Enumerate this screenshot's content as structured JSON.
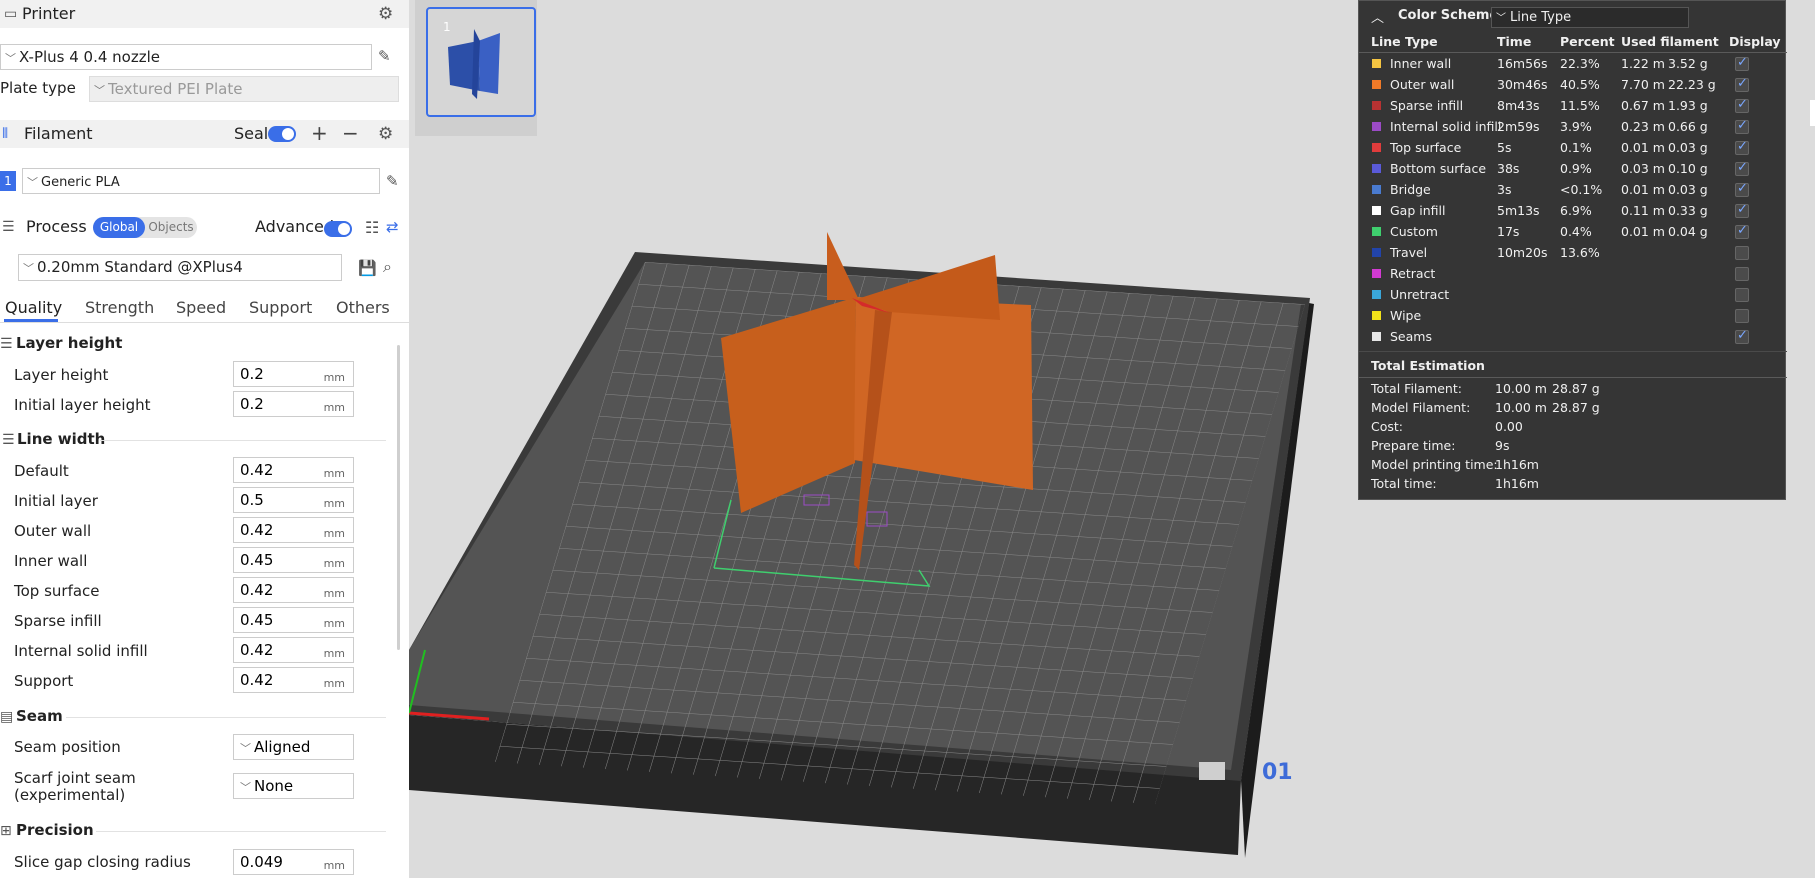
{
  "printer": {
    "title": "Printer",
    "model": "X-Plus 4 0.4 nozzle",
    "plate_label": "Plate type",
    "plate_value": "Textured PEI Plate"
  },
  "filament": {
    "title": "Filament",
    "seal_label": "Seal",
    "slot": "1",
    "value": "Generic PLA"
  },
  "process": {
    "title": "Process",
    "global": "Global",
    "objects": "Objects",
    "advanced": "Advanced",
    "preset": "0.20mm Standard @XPlus4"
  },
  "tabs": [
    "Quality",
    "Strength",
    "Speed",
    "Support",
    "Others"
  ],
  "groups": {
    "layer_height": "Layer height",
    "line_width": "Line width",
    "seam": "Seam",
    "precision": "Precision"
  },
  "params": {
    "layer_height": {
      "label": "Layer height",
      "value": "0.2"
    },
    "initial_layer_height": {
      "label": "Initial layer height",
      "value": "0.2"
    },
    "default": {
      "label": "Default",
      "value": "0.42"
    },
    "initial_layer": {
      "label": "Initial layer",
      "value": "0.5"
    },
    "outer_wall": {
      "label": "Outer wall",
      "value": "0.42"
    },
    "inner_wall": {
      "label": "Inner wall",
      "value": "0.45"
    },
    "top_surface": {
      "label": "Top surface",
      "value": "0.42"
    },
    "sparse_infill": {
      "label": "Sparse infill",
      "value": "0.45"
    },
    "internal_solid_infill": {
      "label": "Internal solid infill",
      "value": "0.42"
    },
    "support": {
      "label": "Support",
      "value": "0.42"
    },
    "seam_position": {
      "label": "Seam position",
      "value": "Aligned"
    },
    "scarf_joint_1": {
      "label": "Scarf joint seam",
      "value": "None"
    },
    "scarf_joint_2": {
      "label": "(experimental)"
    },
    "slice_gap": {
      "label": "Slice gap closing radius",
      "value": "0.049"
    }
  },
  "unit": "mm",
  "plate_thumb": {
    "number": "1"
  },
  "plate_label": "01",
  "legend": {
    "title": "Color Scheme",
    "scheme": "Line Type",
    "headers": [
      "Line Type",
      "Time",
      "Percent",
      "Used filament",
      "Display"
    ],
    "rows": [
      {
        "name": "Inner wall",
        "time": "16m56s",
        "percent": "22.3%",
        "len": "1.22 m",
        "weight": "3.52 g",
        "color": "#f5c542",
        "checked": true
      },
      {
        "name": "Outer wall",
        "time": "30m46s",
        "percent": "40.5%",
        "len": "7.70 m",
        "weight": "22.23 g",
        "color": "#f07a28",
        "checked": true
      },
      {
        "name": "Sparse infill",
        "time": "8m43s",
        "percent": "11.5%",
        "len": "0.67 m",
        "weight": "1.93 g",
        "color": "#b83232",
        "checked": true
      },
      {
        "name": "Internal solid infill",
        "time": "2m59s",
        "percent": "3.9%",
        "len": "0.23 m",
        "weight": "0.66 g",
        "color": "#9b4bc6",
        "checked": true
      },
      {
        "name": "Top surface",
        "time": "5s",
        "percent": "0.1%",
        "len": "0.01 m",
        "weight": "0.03 g",
        "color": "#e03c3c",
        "checked": true
      },
      {
        "name": "Bottom surface",
        "time": "38s",
        "percent": "0.9%",
        "len": "0.03 m",
        "weight": "0.10 g",
        "color": "#5a5ad8",
        "checked": true
      },
      {
        "name": "Bridge",
        "time": "3s",
        "percent": "<0.1%",
        "len": "0.01 m",
        "weight": "0.03 g",
        "color": "#4a7bd0",
        "checked": true
      },
      {
        "name": "Gap infill",
        "time": "5m13s",
        "percent": "6.9%",
        "len": "0.11 m",
        "weight": "0.33 g",
        "color": "#ffffff",
        "checked": true
      },
      {
        "name": "Custom",
        "time": "17s",
        "percent": "0.4%",
        "len": "0.01 m",
        "weight": "0.04 g",
        "color": "#3fcf6e",
        "checked": true
      },
      {
        "name": "Travel",
        "time": "10m20s",
        "percent": "13.6%",
        "len": "",
        "weight": "",
        "color": "#2244aa",
        "checked": false
      },
      {
        "name": "Retract",
        "time": "",
        "percent": "",
        "len": "",
        "weight": "",
        "color": "#d23ad2",
        "checked": false
      },
      {
        "name": "Unretract",
        "time": "",
        "percent": "",
        "len": "",
        "weight": "",
        "color": "#3aa6d8",
        "checked": false
      },
      {
        "name": "Wipe",
        "time": "",
        "percent": "",
        "len": "",
        "weight": "",
        "color": "#f2e21a",
        "checked": false
      },
      {
        "name": "Seams",
        "time": "",
        "percent": "",
        "len": "",
        "weight": "",
        "color": "#e6e6e6",
        "checked": true
      }
    ],
    "total_title": "Total Estimation",
    "totals": [
      {
        "label": "Total Filament:",
        "v1": "10.00 m",
        "v2": "28.87 g"
      },
      {
        "label": "Model Filament:",
        "v1": "10.00 m",
        "v2": "28.87 g"
      },
      {
        "label": "Cost:",
        "v1": "0.00",
        "v2": ""
      },
      {
        "label": "Prepare time:",
        "v1": "9s",
        "v2": ""
      },
      {
        "label": "Model printing time:",
        "v1": "1h16m",
        "v2": ""
      },
      {
        "label": "Total time:",
        "v1": "1h16m",
        "v2": ""
      }
    ]
  }
}
